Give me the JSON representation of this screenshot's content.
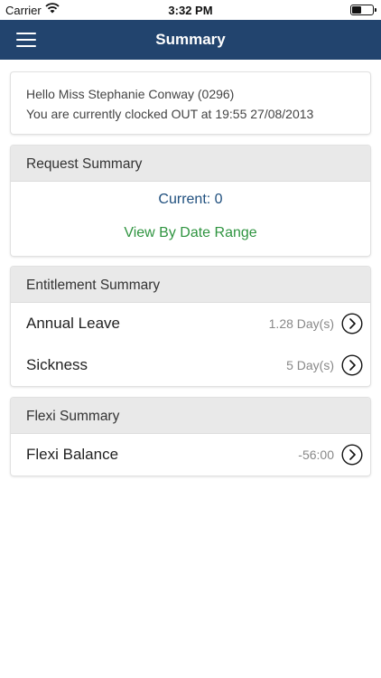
{
  "status": {
    "carrier": "Carrier",
    "time": "3:32 PM",
    "wifi_icon": "wifi-icon",
    "battery_icon": "battery-icon"
  },
  "nav": {
    "title": "Summary",
    "menu_icon": "hamburger-menu-icon"
  },
  "greeting": {
    "line1": "Hello Miss Stephanie Conway (0296)",
    "line2": "You are currently clocked OUT at 19:55 27/08/2013"
  },
  "request": {
    "header": "Request Summary",
    "current": "Current: 0",
    "link": "View By Date Range"
  },
  "entitlement": {
    "header": "Entitlement Summary",
    "rows": [
      {
        "label": "Annual Leave",
        "value": "1.28 Day(s)"
      },
      {
        "label": "Sickness",
        "value": "5 Day(s)"
      }
    ]
  },
  "flexi": {
    "header": "Flexi Summary",
    "rows": [
      {
        "label": "Flexi Balance",
        "value": "-56:00"
      }
    ]
  },
  "colors": {
    "nav": "#22446e",
    "link": "#2f9440",
    "current": "#1f4f7e",
    "header_bg": "#e9e9e9"
  }
}
